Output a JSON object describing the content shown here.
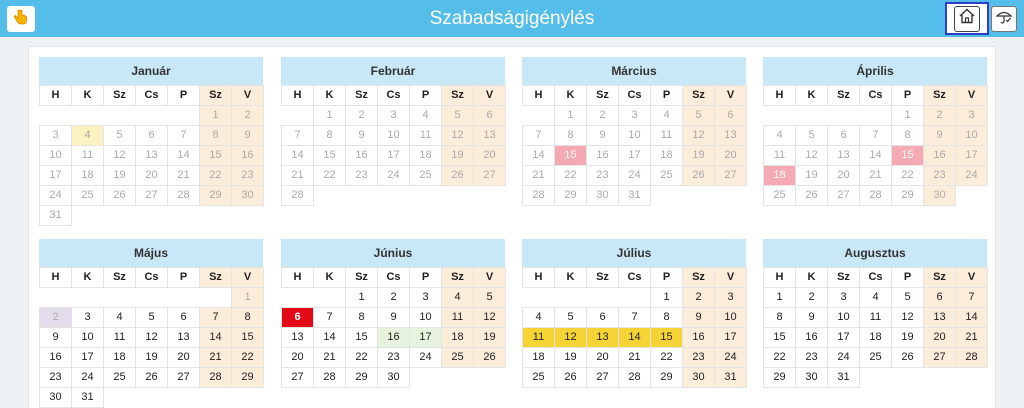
{
  "app": {
    "title": "Szabadságigénylés"
  },
  "toolbar": {
    "left_icon": "hand-pointer-icon",
    "home_icon": "home-icon",
    "right_icon": "beach-umbrella-icon"
  },
  "weekdays": [
    "H",
    "K",
    "Sz",
    "Cs",
    "P",
    "Sz",
    "V"
  ],
  "colors": {
    "header": "#55bdea",
    "month_header": "#c9e8f7",
    "weekend": "#fcecda",
    "today": "#e40b18",
    "approved": "#f7d435",
    "pending": "#e7f3dd",
    "holiday": "#f5a9b3",
    "selected": "#fbf2c1"
  },
  "months": [
    {
      "name": "Január",
      "offset": 5,
      "days": 31,
      "past_until": 31,
      "marks": {
        "4": "sel"
      }
    },
    {
      "name": "Február",
      "offset": 1,
      "days": 28,
      "past_until": 28,
      "marks": {}
    },
    {
      "name": "Március",
      "offset": 1,
      "days": 31,
      "past_until": 31,
      "marks": {
        "15": "blocked"
      }
    },
    {
      "name": "Április",
      "offset": 4,
      "days": 30,
      "past_until": 30,
      "marks": {
        "15": "blocked",
        "18": "blocked"
      }
    },
    {
      "name": "Május",
      "offset": 6,
      "days": 31,
      "past_until": 1,
      "marks": {
        "2": "lilac"
      }
    },
    {
      "name": "Június",
      "offset": 2,
      "days": 30,
      "past_until": 0,
      "marks": {
        "6": "red",
        "16": "green",
        "17": "green"
      }
    },
    {
      "name": "Július",
      "offset": 4,
      "days": 31,
      "past_until": 0,
      "marks": {
        "11": "yellow",
        "12": "yellow",
        "13": "yellow",
        "14": "yellow",
        "15": "yellow"
      }
    },
    {
      "name": "Augusztus",
      "offset": 0,
      "days": 31,
      "past_until": 0,
      "marks": {}
    }
  ]
}
